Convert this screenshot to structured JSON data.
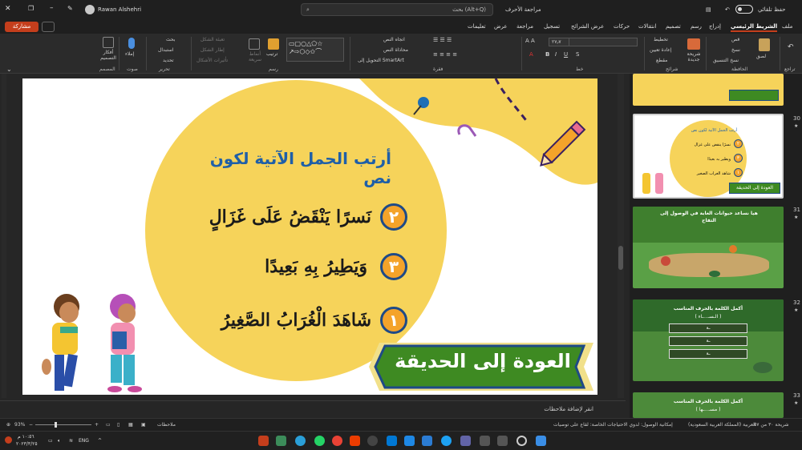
{
  "titlebar": {
    "user_name": "Rawan Alshehri",
    "search_placeholder": "بحث (Alt+Q)",
    "fonts_review": "مراجعة الأحرف",
    "autosave_label": "حفظ تلقائي",
    "on_label": "تشغيل"
  },
  "tabs": {
    "share": "مشاركة",
    "items": [
      "ملف",
      "الشريط الرئيسي",
      "إدراج",
      "رسم",
      "تصميم",
      "انتقالات",
      "حركات",
      "عرض الشرائح",
      "تسجيل",
      "مراجعة",
      "عرض",
      "تعليمات"
    ]
  },
  "ribbon": {
    "undo_group": "تراجع",
    "clipboard": {
      "paste": "لصق",
      "cut": "قص",
      "copy": "نسخ",
      "format_painter": "نسخ التنسيق",
      "group": "الحافظة"
    },
    "slides": {
      "new_slide": "شريحة جديدة",
      "layout": "تخطيط",
      "reset": "إعادة تعيين",
      "section": "مقطع",
      "group": "شرائح"
    },
    "font": {
      "group": "خط",
      "size": "٢٧٫٧"
    },
    "paragraph": {
      "text_direction": "اتجاه النص",
      "align_text": "محاذاة النص",
      "smartart": "التحويل إلى SmartArt",
      "group": "فقرة"
    },
    "drawing": {
      "arrange": "ترتيب",
      "quick_styles": "أنماط سريعة",
      "shape_fill": "تعبئة الشكل",
      "shape_outline": "إطار الشكل",
      "shape_effects": "تأثيرات الأشكال",
      "group": "رسم"
    },
    "editing": {
      "find": "بحث",
      "replace": "استبدال",
      "select": "تحديد",
      "group": "تحرير"
    },
    "voice": {
      "dictate": "إملاء",
      "group": "صوت"
    },
    "designer": {
      "ideas": "أفكار التصميم",
      "group": "المصمم"
    }
  },
  "slide": {
    "title": "أرتب الجمل الآتية لكون نص",
    "rows": [
      {
        "num": "٢",
        "text": "نَسرًا يَنْقَضُ عَلَى غَزَالٍ"
      },
      {
        "num": "٣",
        "text": "وَيَطِيرُ بِهِ بَعِيدًا"
      },
      {
        "num": "١",
        "text": "شَاهَدَ الْغُرَابُ الصَّغِيرُ"
      }
    ],
    "banner": "العودة إلى الحديقة"
  },
  "notes": {
    "placeholder": "انقر لإضافة ملاحظات"
  },
  "thumbnails": [
    {
      "num": "30",
      "star": "★",
      "title": "أرتب الجمل الآتية لكون نص",
      "rows": [
        "نسرًا ينقض على غزال",
        "ويطير به بعيدًا",
        "شاهد الغراب الصغير"
      ],
      "nums": [
        "٢",
        "٣",
        "١"
      ],
      "banner": "العودة إلى الحديقة"
    },
    {
      "num": "31",
      "star": "★",
      "title": "هيا نساعد حيوانات الغابة في الوصول إلى التفاح"
    },
    {
      "num": "32",
      "star": "★",
      "title": "أكمل الكلمة بالحرف المناسب",
      "word": "( الـسـ...ـاء )",
      "opts": [
        "ـة",
        "ـة",
        "ـة"
      ]
    },
    {
      "num": "33",
      "star": "★",
      "title": "أكمل الكلمة بالحرف المناسب",
      "word": "( مسـ...ـها )"
    }
  ],
  "status": {
    "slide_info": "شريحة ٣٠ من ٥٧",
    "language": "العربية (المملكة العربية السعودية)",
    "accessibility": "إمكانية الوصول: لدوي الاحتياجات الخاصة: لقاع على توصيات",
    "notes": "ملاحظات",
    "zoom": "93%"
  },
  "taskbar": {
    "lang": "ENG",
    "time": "١٠:٥٦ م",
    "date": "٢٠٢٣/٣/٢٥"
  },
  "colors": {
    "accent": "#c43e1c",
    "slide_circle": "#f6d35a",
    "banner_green": "#3e8a22",
    "num_orange": "#f4a32a",
    "num_border": "#1e4a87",
    "title_blue": "#1f5fa8"
  }
}
